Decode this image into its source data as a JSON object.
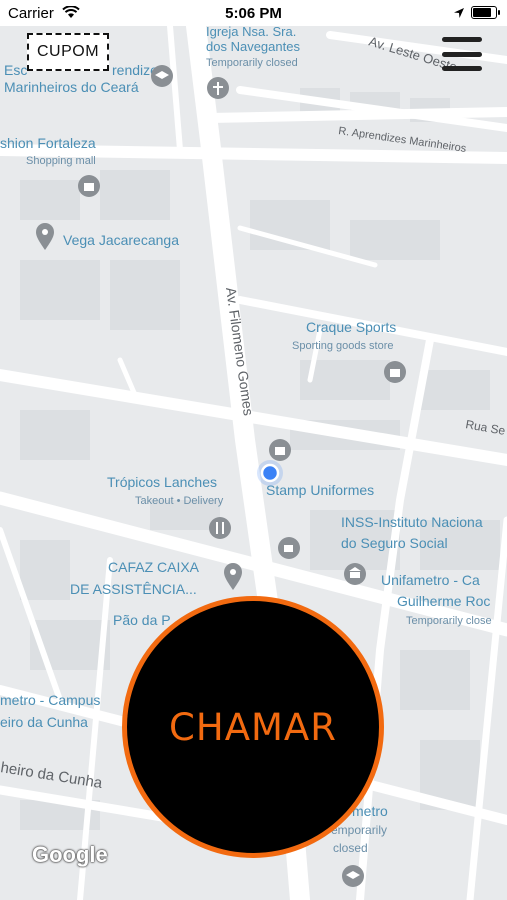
{
  "status_bar": {
    "carrier": "Carrier",
    "time": "5:06 PM",
    "battery_level": 0.9
  },
  "coupon_button": {
    "label": "CUPOM"
  },
  "call_button": {
    "label": "CHAMAR"
  },
  "google_logo": "Google",
  "colors": {
    "accent": "#f26a10",
    "call_bg": "#000000",
    "map_bg": "#e8eaec",
    "road": "#ffffff",
    "poi_text": "#4b8fb5",
    "poi_icon": "#8a8f94",
    "location_dot": "#3b82f6"
  },
  "map": {
    "streets": {
      "filomeno_gomes": "Av. Filomeno Gomes",
      "leste_oeste": "Av. Leste Oeste",
      "aprendizes": "R. Aprendizes Marinheiros",
      "rua_se": "Rua Se",
      "cunha": "heiro da Cunha"
    },
    "places": {
      "igreja_1": "Igreja Nsa. Sra.",
      "igreja_2": "dos Navegantes",
      "igreja_status": "Temporarily closed",
      "escola_1": "Esc",
      "escola_2": "rendizes",
      "escola_3": "Marinheiros do Ceará",
      "fashion": "shion Fortaleza",
      "fashion_sub": "Shopping mall",
      "vega": "Vega Jacarecanga",
      "craque": "Craque Sports",
      "craque_sub": "Sporting goods store",
      "tropicos": "Trópicos Lanches",
      "tropicos_sub": "Takeout • Delivery",
      "stamp": "Stamp Uniformes",
      "inss_1": "INSS-Instituto Naciona",
      "inss_2": "do Seguro Social",
      "cafaz_1": "CAFAZ CAIXA",
      "cafaz_2": "DE ASSISTÊNCIA...",
      "unifametro_1": "Unifametro - Ca",
      "unifametro_2": "Guilherme Roc",
      "unifametro_status": "Temporarily close",
      "pao": "Pão da P",
      "campus_1": "metro - Campus",
      "campus_2": "eiro da Cunha",
      "metro_2": "metro",
      "metro_2_status_1": "emporarily",
      "metro_2_status_2": "closed"
    }
  }
}
